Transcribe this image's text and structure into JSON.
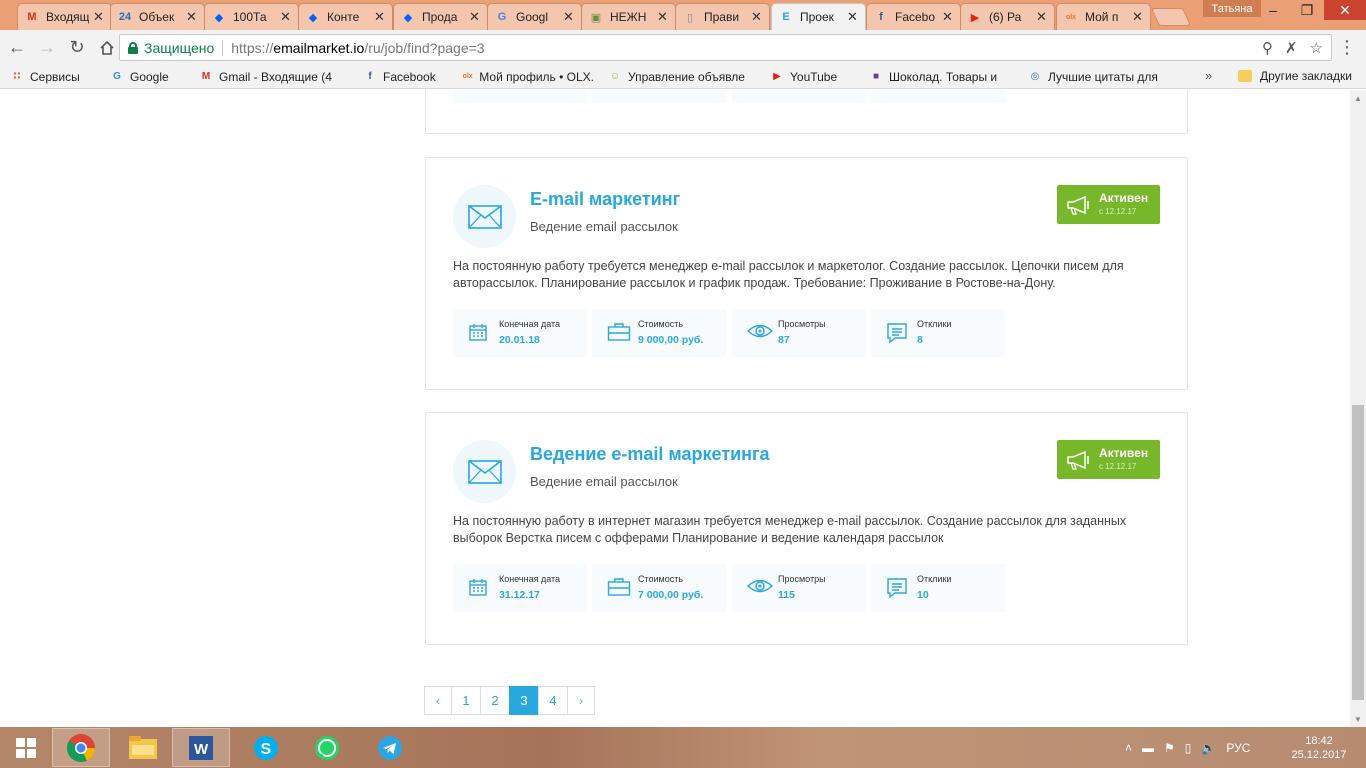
{
  "tabs": [
    {
      "title": "Входящ",
      "favicon": "gmail-icon",
      "color": "#d93025",
      "glyph": "M"
    },
    {
      "title": "Объек",
      "favicon": "24-icon",
      "color": "#2a6ebb",
      "glyph": "24"
    },
    {
      "title": "100Та",
      "favicon": "dropbox-icon",
      "color": "#0061fe",
      "glyph": "◆"
    },
    {
      "title": "Конте",
      "favicon": "dropbox-icon",
      "color": "#0061fe",
      "glyph": "◆"
    },
    {
      "title": "Прода",
      "favicon": "dropbox-icon",
      "color": "#0061fe",
      "glyph": "◆"
    },
    {
      "title": "Googl",
      "favicon": "google-docs-icon",
      "color": "#4285f4",
      "glyph": "G"
    },
    {
      "title": "НЕЖН",
      "favicon": "image-icon",
      "color": "#6a8f3a",
      "glyph": "▣"
    },
    {
      "title": "Прави",
      "favicon": "page-icon",
      "color": "#888888",
      "glyph": "▯"
    },
    {
      "title": "Проек",
      "favicon": "emailmarket-icon",
      "color": "#29a8e0",
      "glyph": "E"
    },
    {
      "title": "Facebo",
      "favicon": "facebook-icon",
      "color": "#3b5998",
      "glyph": "f"
    },
    {
      "title": "(6) Ра",
      "favicon": "youtube-icon",
      "color": "#e62117",
      "glyph": "▶"
    },
    {
      "title": "Мой п",
      "favicon": "olx-icon",
      "color": "#e2742b",
      "glyph": "olx"
    }
  ],
  "active_tab_index": 8,
  "user_name": "Татьяна",
  "toolbar": {
    "secure_label": "Защищено",
    "url_scheme": "https://",
    "url_host": "emailmarket.io",
    "url_path": "/ru/job/find?page=3"
  },
  "bookmarks": [
    {
      "label": "Сервисы",
      "icon": "apps-icon",
      "color": "#e94235"
    },
    {
      "label": "Google",
      "icon": "google-icon",
      "color": "#4285f4"
    },
    {
      "label": "Gmail - Входящие (4",
      "icon": "gmail-icon",
      "color": "#d93025"
    },
    {
      "label": "Facebook",
      "icon": "facebook-icon",
      "color": "#3b5998"
    },
    {
      "label": "Мой профиль • OLX.",
      "icon": "olx-icon",
      "color": "#e2742b"
    },
    {
      "label": "Управление объявле",
      "icon": "smiley-icon",
      "color": "#8fc33a"
    },
    {
      "label": "YouTube",
      "icon": "youtube-icon",
      "color": "#e62117"
    },
    {
      "label": "Шоколад. Товары и",
      "icon": "shop-icon",
      "color": "#6a3e9a"
    },
    {
      "label": "Лучшие цитаты для",
      "icon": "globe-icon",
      "color": "#2a6ebb"
    }
  ],
  "bookmarks_other": "Другие закладки",
  "jobs": [
    {
      "title": "E-mail маркетинг",
      "subtitle": "Ведение email рассылок",
      "status": "Активен",
      "status_since": "с 12.12.17",
      "description": "На постоянную работу требуется менеджер e-mail рассылок и маркетолог. Создание рассылок. Цепочки писем для авторассылок. Планирование рассылок и график продаж.  Требование: Проживание в Ростове-на-Дону.",
      "stats": [
        {
          "label": "Конечная дата",
          "value": "20.01.18",
          "icon": "calendar-icon"
        },
        {
          "label": "Стоимость",
          "value": "9 000,00 руб.",
          "icon": "briefcase-icon"
        },
        {
          "label": "Просмотры",
          "value": "87",
          "icon": "eye-icon"
        },
        {
          "label": "Отклики",
          "value": "8",
          "icon": "comment-icon"
        }
      ]
    },
    {
      "title": "Ведение e-mail маркетинга",
      "subtitle": "Ведение email рассылок",
      "status": "Активен",
      "status_since": "с 12.12.17",
      "description": "На постоянную работу в интернет магазин требуется менеджер e-mail рассылок.  Создание рассылок для заданных выборок Верстка писем с офферами  Планирование и ведение календаря рассылок",
      "stats": [
        {
          "label": "Конечная дата",
          "value": "31.12.17",
          "icon": "calendar-icon"
        },
        {
          "label": "Стоимость",
          "value": "7 000,00 руб.",
          "icon": "briefcase-icon"
        },
        {
          "label": "Просмотры",
          "value": "115",
          "icon": "eye-icon"
        },
        {
          "label": "Отклики",
          "value": "10",
          "icon": "comment-icon"
        }
      ]
    }
  ],
  "pagination": {
    "prev": "‹",
    "pages": [
      "1",
      "2",
      "3",
      "4"
    ],
    "current": "3",
    "next": "›"
  },
  "taskbar": {
    "apps": [
      "chrome-icon",
      "file-explorer-icon",
      "word-icon",
      "skype-icon",
      "whatsapp-icon",
      "telegram-icon"
    ],
    "language": "РУС",
    "time": "18:42",
    "date": "25.12.2017"
  },
  "colors": {
    "accent": "#29a8e0",
    "status_green": "#76b82a",
    "secure_green": "#0b8043",
    "tabstrip": "#ea9f74"
  }
}
